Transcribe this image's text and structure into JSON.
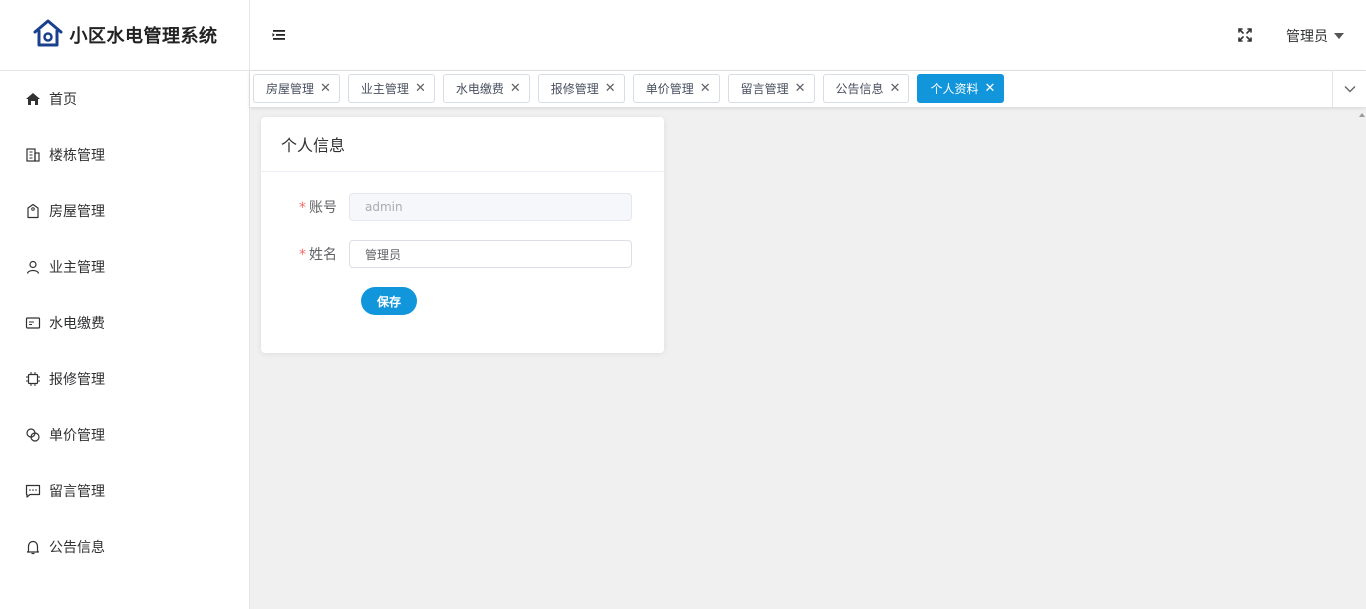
{
  "app": {
    "title": "小区水电管理系统",
    "accent": "#1296db"
  },
  "sidebar": {
    "items": [
      {
        "label": "首页",
        "icon": "home-icon"
      },
      {
        "label": "楼栋管理",
        "icon": "building-icon"
      },
      {
        "label": "房屋管理",
        "icon": "house-tag-icon"
      },
      {
        "label": "业主管理",
        "icon": "user-icon"
      },
      {
        "label": "水电缴费",
        "icon": "payment-card-icon"
      },
      {
        "label": "报修管理",
        "icon": "chip-icon"
      },
      {
        "label": "单价管理",
        "icon": "price-link-icon"
      },
      {
        "label": "留言管理",
        "icon": "message-icon"
      },
      {
        "label": "公告信息",
        "icon": "bell-icon"
      }
    ]
  },
  "header": {
    "user_label": "管理员"
  },
  "tabs": [
    {
      "label": "房屋管理",
      "active": false
    },
    {
      "label": "业主管理",
      "active": false
    },
    {
      "label": "水电缴费",
      "active": false
    },
    {
      "label": "报修管理",
      "active": false
    },
    {
      "label": "单价管理",
      "active": false
    },
    {
      "label": "留言管理",
      "active": false
    },
    {
      "label": "公告信息",
      "active": false
    },
    {
      "label": "个人资料",
      "active": true
    }
  ],
  "profile": {
    "card_title": "个人信息",
    "account_label": "账号",
    "account_value": "admin",
    "name_label": "姓名",
    "name_value": "管理员",
    "save_label": "保存"
  }
}
